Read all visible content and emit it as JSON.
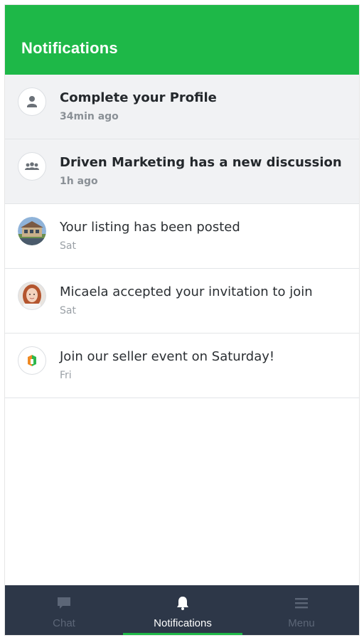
{
  "header": {
    "title": "Notifications"
  },
  "notifications": [
    {
      "title": "Complete your Profile",
      "time": "34min ago",
      "unread": true,
      "icon": "person-icon"
    },
    {
      "title": "Driven Marketing has a new discussion",
      "time": "1h ago",
      "unread": true,
      "icon": "group-icon"
    },
    {
      "title": "Your listing has been posted",
      "time": "Sat",
      "unread": false,
      "icon": "house-photo-icon"
    },
    {
      "title": "Micaela accepted your invitation to join",
      "time": "Sat",
      "unread": false,
      "icon": "user-photo-icon"
    },
    {
      "title": "Join our seller event on Saturday!",
      "time": "Fri",
      "unread": false,
      "icon": "brand-logo-icon"
    }
  ],
  "tabbar": {
    "tabs": [
      {
        "label": "Chat",
        "icon": "chat-icon",
        "active": false
      },
      {
        "label": "Notifications",
        "icon": "bell-icon",
        "active": true
      },
      {
        "label": "Menu",
        "icon": "menu-icon",
        "active": false
      }
    ]
  },
  "colors": {
    "brand_green": "#1eb848",
    "tabbar_bg": "#2d3748",
    "unread_bg": "#f1f2f4"
  }
}
